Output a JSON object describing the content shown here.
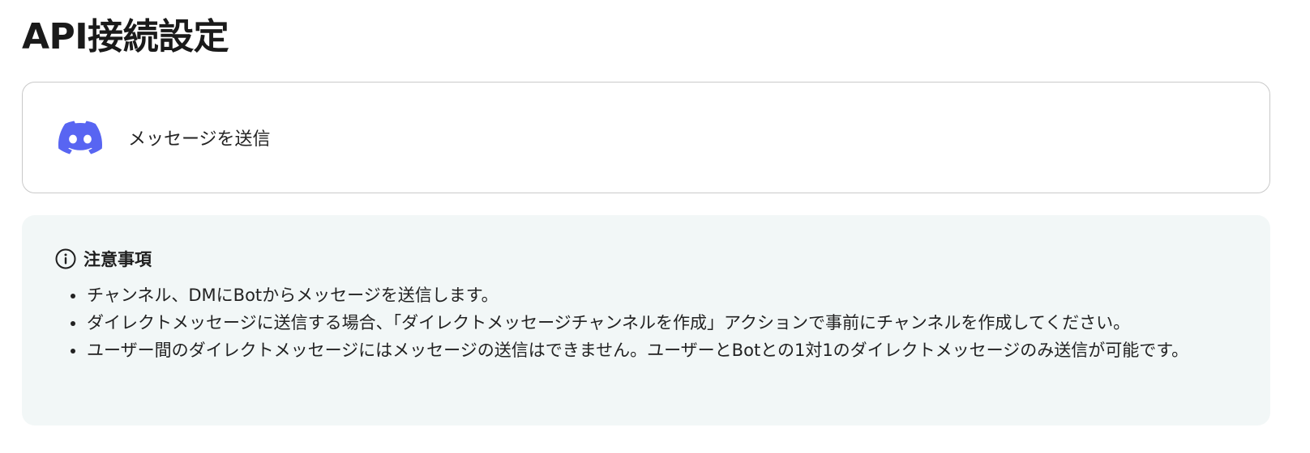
{
  "page": {
    "title": "API接続設定"
  },
  "action": {
    "icon": "discord-icon",
    "label": "メッセージを送信",
    "brand_color": "#5865F2"
  },
  "notice": {
    "icon": "info-circle-icon",
    "title": "注意事項",
    "background": "#F2F7F7",
    "items": [
      "チャンネル、DMにBotからメッセージを送信します。",
      "ダイレクトメッセージに送信する場合、「ダイレクトメッセージチャンネルを作成」アクションで事前にチャンネルを作成してください。",
      "ユーザー間のダイレクトメッセージにはメッセージの送信はできません。ユーザーとBotとの1対1のダイレクトメッセージのみ送信が可能です。"
    ]
  }
}
